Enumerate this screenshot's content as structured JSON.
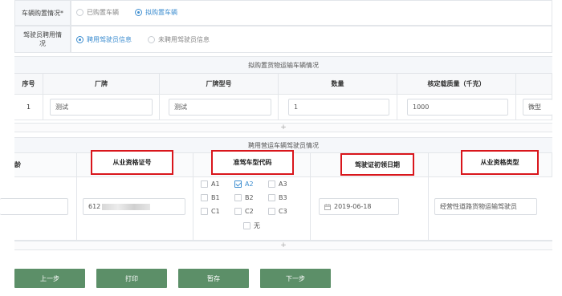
{
  "purchase": {
    "label": "车辆购置情况",
    "required_mark": "*",
    "options": [
      "已购置车辆",
      "拟购置车辆"
    ],
    "selected": "拟购置车辆"
  },
  "driver_hire": {
    "label": "驾驶员聘用情况",
    "options": [
      "聘用驾驶员信息",
      "未聘用驾驶员信息"
    ],
    "selected": "聘用驾驶员信息"
  },
  "vehicle_section": {
    "title": "拟购置货物运输车辆情况",
    "columns": [
      "序号",
      "厂牌",
      "厂牌型号",
      "数量",
      "核定载质量（千克）"
    ],
    "row": {
      "index": "1",
      "brand": "测试",
      "model": "测试",
      "quantity": "1",
      "load": "1000",
      "truncated": "微型"
    },
    "add": "+"
  },
  "driver_section": {
    "title": "聘用营运车辆驾驶员情况",
    "left_fragment": "龄",
    "columns": [
      "从业资格证号",
      "准驾车型代码",
      "驾驶证初领日期",
      "从业资格类型"
    ],
    "row": {
      "cert_no_prefix": "612",
      "license_codes": [
        "A1",
        "A2",
        "A3",
        "B1",
        "B2",
        "B3",
        "C1",
        "C2",
        "C3",
        "无"
      ],
      "checked_code": "A2",
      "first_issue_date": "2019-06-18",
      "qual_type": "经营性道路货物运输驾驶员"
    },
    "add": "+"
  },
  "buttons": {
    "prev": "上一步",
    "print": "打印",
    "save": "暂存",
    "next": "下一步"
  },
  "colors": {
    "accent": "#3e8ed0",
    "button": "#5c8f68",
    "highlight": "#d9161c"
  }
}
